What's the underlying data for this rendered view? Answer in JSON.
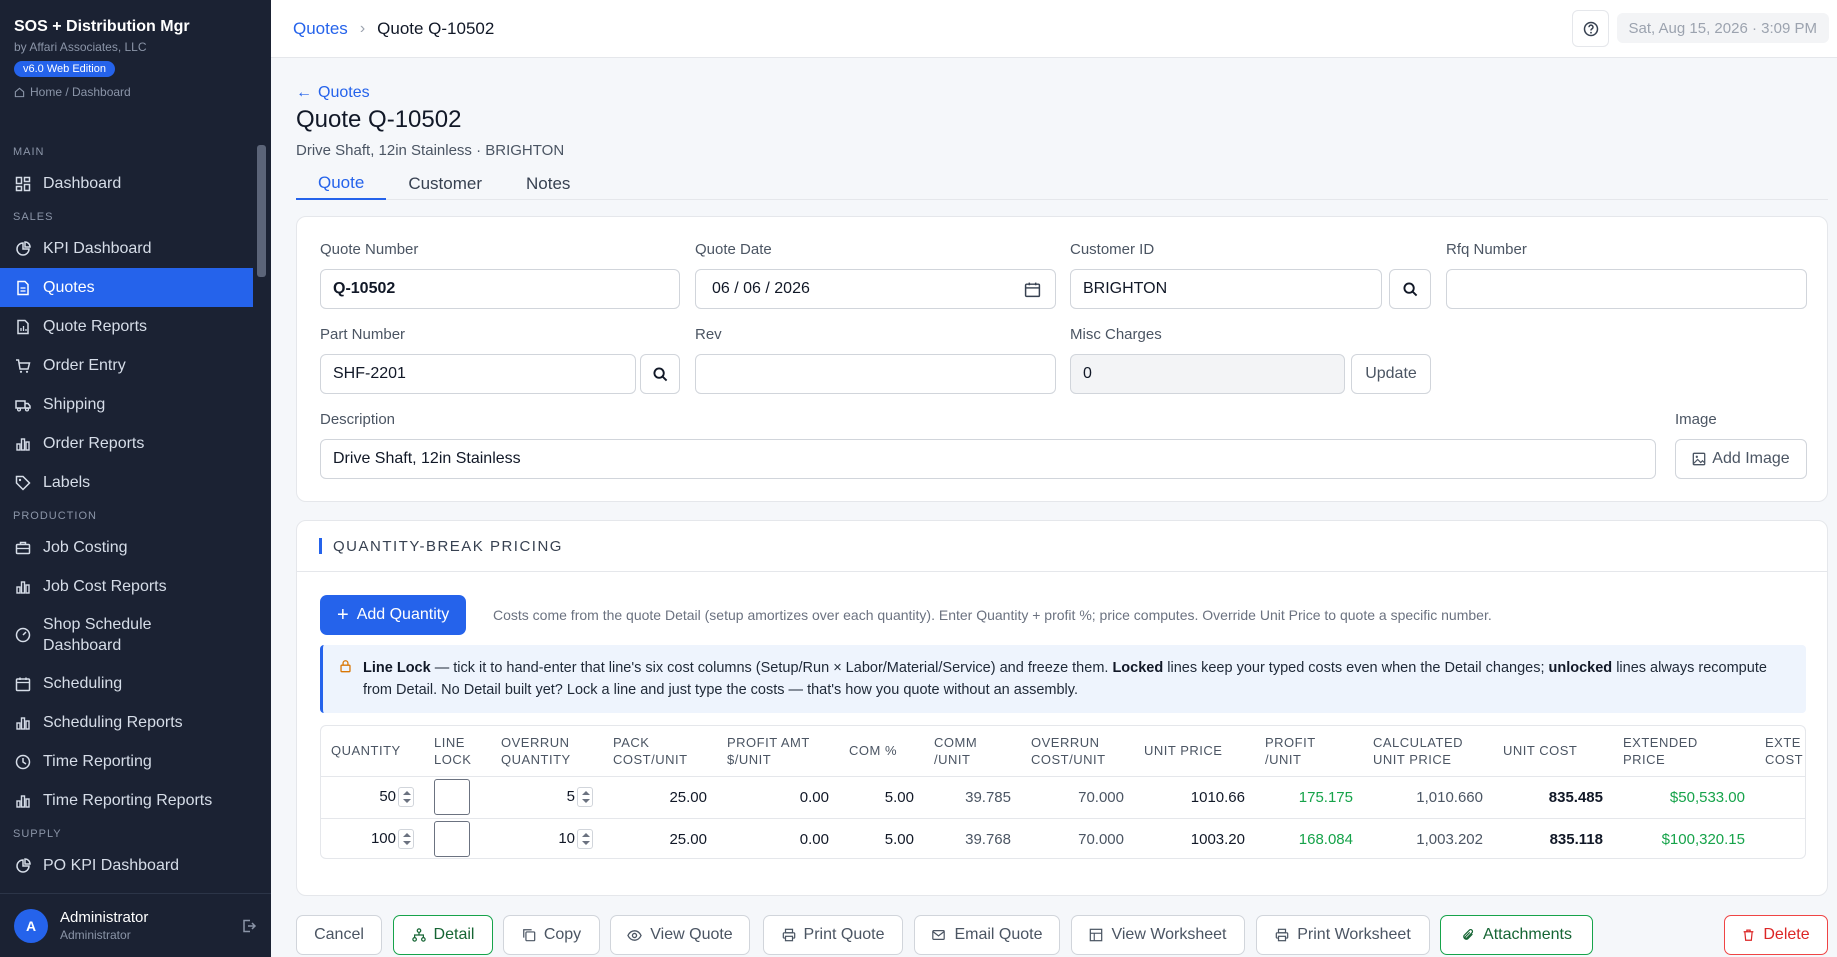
{
  "app": {
    "title": "SOS + Distribution Mgr",
    "subtitle": "by Affari Associates, LLC",
    "edition": "v6.0 Web Edition",
    "crumb": "Home / Dashboard"
  },
  "nav": {
    "sections": {
      "main": "MAIN",
      "sales": "SALES",
      "production": "PRODUCTION",
      "supply": "SUPPLY"
    },
    "items": {
      "dashboard": "Dashboard",
      "kpi_dashboard": "KPI Dashboard",
      "quotes": "Quotes",
      "quote_reports": "Quote Reports",
      "order_entry": "Order Entry",
      "shipping": "Shipping",
      "order_reports": "Order Reports",
      "labels": "Labels",
      "job_costing": "Job Costing",
      "job_cost_reports": "Job Cost Reports",
      "shop_schedule_1": "Shop Schedule",
      "shop_schedule_2": "Dashboard",
      "scheduling": "Scheduling",
      "scheduling_reports": "Scheduling Reports",
      "time_reporting": "Time Reporting",
      "time_reporting_reports": "Time Reporting Reports",
      "po_kpi_dashboard": "PO KPI Dashboard"
    }
  },
  "user": {
    "name": "Administrator",
    "role": "Administrator",
    "initial": "A"
  },
  "topbar": {
    "crumb_parent": "Quotes",
    "crumb_current": "Quote Q-10502",
    "datetime": "Sat, Aug 15, 2026 · 3:09 PM"
  },
  "page": {
    "back": "Quotes",
    "title": "Quote Q-10502",
    "subtitle": "Drive Shaft, 12in Stainless · BRIGHTON",
    "tabs": {
      "quote": "Quote",
      "customer": "Customer",
      "notes": "Notes"
    }
  },
  "form": {
    "quote_number": {
      "label": "Quote Number",
      "value": "Q-10502"
    },
    "quote_date": {
      "label": "Quote Date",
      "value": "06 / 06 / 2026"
    },
    "customer_id": {
      "label": "Customer ID",
      "value": "BRIGHTON"
    },
    "rfq_number": {
      "label": "Rfq Number",
      "value": ""
    },
    "part_number": {
      "label": "Part Number",
      "value": "SHF-2201"
    },
    "rev": {
      "label": "Rev",
      "value": ""
    },
    "misc_charges": {
      "label": "Misc Charges",
      "value": "0"
    },
    "update_label": "Update",
    "description": {
      "label": "Description",
      "value": "Drive Shaft, 12in Stainless"
    },
    "image": {
      "label": "Image",
      "button": "Add Image"
    }
  },
  "qbp": {
    "title": "QUANTITY-BREAK PRICING",
    "add_label": "Add Quantity",
    "help": "Costs come from the quote Detail (setup amortizes over each quantity). Enter Quantity + profit %; price computes. Override Unit Price to quote a specific number.",
    "notice": {
      "p1": "Line Lock",
      "p2": " — tick it to hand-enter that line's six cost columns (Setup/Run × Labor/Material/Service) and freeze them. ",
      "p3": "Locked",
      "p4": " lines keep your typed costs even when the Detail changes; ",
      "p5": "unlocked",
      "p6": " lines always recompute from Detail. No Detail built yet? Lock a line and just type the costs — that's how you quote without an assembly."
    },
    "columns": [
      [
        "QUANTITY",
        ""
      ],
      [
        "LINE",
        "LOCK"
      ],
      [
        "OVERRUN",
        "QUANTITY"
      ],
      [
        "PACK",
        "COST/UNIT"
      ],
      [
        "PROFIT AMT",
        "$/UNIT"
      ],
      [
        "COM %",
        ""
      ],
      [
        "COMM",
        "/UNIT"
      ],
      [
        "OVERRUN",
        "COST/UNIT"
      ],
      [
        "UNIT PRICE",
        ""
      ],
      [
        "PROFIT",
        "/UNIT"
      ],
      [
        "CALCULATED",
        "UNIT PRICE"
      ],
      [
        "UNIT COST",
        ""
      ],
      [
        "EXTENDED",
        "PRICE"
      ],
      [
        "EXTE",
        "COST"
      ]
    ],
    "rows": [
      [
        "50",
        "",
        "5",
        "25.00",
        "0.00",
        "5.00",
        "39.785",
        "70.000",
        "1010.66",
        "175.175",
        "1,010.660",
        "835.485",
        "$50,533.00",
        ""
      ],
      [
        "100",
        "",
        "10",
        "25.00",
        "0.00",
        "5.00",
        "39.768",
        "70.000",
        "1003.20",
        "168.084",
        "1,003.202",
        "835.118",
        "$100,320.15",
        ""
      ]
    ]
  },
  "actions": {
    "cancel": "Cancel",
    "detail": "Detail",
    "copy": "Copy",
    "view_quote": "View Quote",
    "print_quote": "Print Quote",
    "email_quote": "Email Quote",
    "view_worksheet": "View Worksheet",
    "print_worksheet": "Print Worksheet",
    "attachments": "Attachments",
    "delete": "Delete"
  },
  "colors": {
    "accent": "#2563eb",
    "sidebar": "#1b2233",
    "positive": "#16a34a",
    "danger": "#ef4444"
  }
}
